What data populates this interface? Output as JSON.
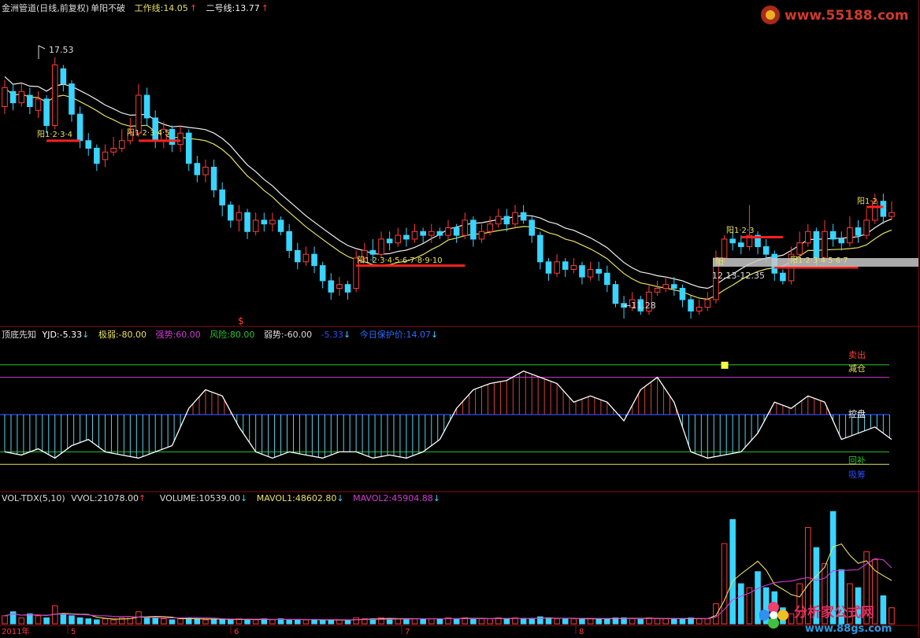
{
  "main_header": {
    "title": "金洲管道(日线,前复权)",
    "indicator": "单阳不破",
    "work_line_label": "工作线:",
    "work_line_value": "14.05",
    "line2_label": "二号线:",
    "line2_value": "13.77"
  },
  "main_annotations": {
    "high_price": "17.53",
    "low_price": "←11.28",
    "range": "12.13-12.35",
    "band_label": "阳",
    "sell_marker": "$",
    "yang_labels": [
      {
        "text": "阳1·2·3·4"
      },
      {
        "text": "阳1·2·3·4·5"
      },
      {
        "text": "阳1·2·3·4·5·6·7·8·9·10"
      },
      {
        "text": "阳1·2·3"
      },
      {
        "text": "阳1·2·3·4·5·6·7"
      },
      {
        "text": "阳1·2"
      }
    ]
  },
  "osc_header": {
    "name": "顶底先知",
    "yjd": "YJD:-5.33",
    "jiruo": "极弱:-80.00",
    "qiangshi": "强势:60.00",
    "fengxian": "风险:80.00",
    "ruoshi": "弱势:-60.00",
    "value2": "-5.33",
    "protect": "今日保护价:14.07"
  },
  "osc_labels": {
    "sell": "卖出",
    "reduce": "减仓",
    "control": "控盘",
    "backfill": "回补",
    "buy": "吸筹"
  },
  "vol_header": {
    "name": "VOL-TDX(5,10)",
    "vvol": "VVOL:21078.00",
    "volume": "VOLUME:10539.00",
    "mavol1": "MAVOL1:48602.80",
    "mavol2": "MAVOL2:45904.88"
  },
  "date_axis": {
    "year": "2011年",
    "months": [
      "5",
      "6",
      "7",
      "8"
    ]
  },
  "watermarks": {
    "top": "www.55188.com",
    "bottom_cn": "分析家公式网",
    "bottom_url": "www.88gs.com"
  },
  "colors": {
    "up": "#ff3b3b",
    "down": "#39d4ff",
    "ma1": "#f0f0f0",
    "ma2": "#e8e060",
    "osc_line": "#ffffff",
    "level_green": "#29c529",
    "level_magenta": "#d23cd2",
    "level_blue": "#2a4cff",
    "level_yellow": "#e8e060"
  },
  "chart_data": [
    {
      "type": "candlestick",
      "title": "金洲管道(日线,前复权)",
      "ylim": [
        10.6,
        18.6
      ],
      "note_points": {
        "high": 17.53,
        "low": 11.28
      },
      "candles": [
        [
          16.2,
          16.7,
          16.9,
          16.0
        ],
        [
          16.6,
          16.3,
          16.8,
          16.1
        ],
        [
          16.3,
          16.6,
          16.8,
          16.2
        ],
        [
          16.5,
          16.2,
          16.7,
          16.0
        ],
        [
          16.1,
          16.4,
          16.6,
          15.9
        ],
        [
          16.4,
          15.7,
          16.5,
          15.5
        ],
        [
          15.7,
          17.3,
          17.5,
          15.6
        ],
        [
          17.2,
          16.8,
          17.3,
          16.6
        ],
        [
          16.8,
          16.0,
          16.9,
          15.8
        ],
        [
          16.0,
          15.3,
          16.2,
          15.1
        ],
        [
          15.3,
          15.1,
          15.5,
          14.9
        ],
        [
          15.1,
          14.7,
          15.2,
          14.5
        ],
        [
          14.8,
          15.0,
          15.2,
          14.6
        ],
        [
          15.0,
          15.1,
          15.4,
          14.9
        ],
        [
          15.1,
          15.3,
          15.6,
          15.0
        ],
        [
          15.3,
          15.5,
          15.9,
          15.2
        ],
        [
          15.5,
          16.5,
          16.8,
          15.4
        ],
        [
          16.5,
          15.9,
          16.7,
          15.7
        ],
        [
          15.9,
          15.3,
          16.1,
          15.1
        ],
        [
          15.3,
          15.6,
          15.8,
          15.1
        ],
        [
          15.6,
          15.2,
          15.7,
          15.0
        ],
        [
          15.2,
          15.5,
          15.7,
          15.0
        ],
        [
          15.5,
          14.7,
          15.6,
          14.5
        ],
        [
          14.7,
          14.4,
          14.9,
          14.2
        ],
        [
          14.4,
          14.6,
          14.8,
          14.2
        ],
        [
          14.6,
          14.0,
          14.8,
          13.8
        ],
        [
          14.0,
          13.6,
          14.2,
          13.3
        ],
        [
          13.6,
          13.2,
          13.7,
          13.0
        ],
        [
          13.2,
          13.4,
          13.6,
          12.9
        ],
        [
          13.4,
          12.9,
          13.5,
          12.7
        ],
        [
          12.9,
          13.2,
          13.4,
          12.8
        ],
        [
          13.2,
          13.1,
          13.4,
          12.9
        ],
        [
          13.1,
          13.2,
          13.4,
          12.9
        ],
        [
          13.2,
          12.9,
          13.3,
          12.8
        ],
        [
          12.9,
          12.4,
          13.1,
          12.2
        ],
        [
          12.4,
          12.1,
          12.6,
          11.9
        ],
        [
          12.1,
          12.3,
          12.5,
          12.0
        ],
        [
          12.3,
          12.0,
          12.5,
          11.8
        ],
        [
          12.0,
          11.6,
          12.1,
          11.4
        ],
        [
          11.6,
          11.3,
          11.8,
          11.1
        ],
        [
          11.4,
          11.5,
          11.7,
          11.2
        ],
        [
          11.5,
          11.3,
          11.6,
          11.1
        ],
        [
          11.4,
          12.2,
          12.4,
          11.3
        ],
        [
          12.2,
          12.4,
          12.6,
          12.1
        ],
        [
          12.4,
          12.3,
          12.7,
          12.1
        ],
        [
          12.3,
          12.7,
          12.9,
          12.2
        ],
        [
          12.7,
          12.6,
          12.9,
          12.4
        ],
        [
          12.6,
          12.8,
          13.0,
          12.5
        ],
        [
          12.8,
          12.7,
          13.0,
          12.5
        ],
        [
          12.7,
          12.9,
          13.1,
          12.6
        ],
        [
          12.9,
          12.8,
          13.0,
          12.6
        ],
        [
          12.8,
          12.9,
          13.1,
          12.6
        ],
        [
          12.9,
          12.8,
          13.0,
          12.7
        ],
        [
          12.8,
          13.0,
          13.2,
          12.7
        ],
        [
          13.0,
          12.8,
          13.1,
          12.6
        ],
        [
          12.8,
          13.2,
          13.4,
          12.7
        ],
        [
          13.2,
          12.7,
          13.3,
          12.5
        ],
        [
          12.7,
          12.9,
          13.1,
          12.6
        ],
        [
          12.9,
          13.1,
          13.3,
          12.8
        ],
        [
          13.1,
          13.3,
          13.5,
          13.0
        ],
        [
          13.3,
          13.1,
          13.5,
          12.9
        ],
        [
          13.1,
          13.4,
          13.6,
          13.0
        ],
        [
          13.4,
          13.2,
          13.6,
          13.1
        ],
        [
          13.2,
          12.8,
          13.3,
          12.6
        ],
        [
          12.8,
          12.1,
          12.9,
          11.9
        ],
        [
          12.1,
          11.8,
          12.2,
          11.6
        ],
        [
          11.8,
          12.1,
          12.3,
          11.7
        ],
        [
          12.1,
          11.9,
          12.2,
          11.7
        ],
        [
          11.9,
          12.0,
          12.2,
          11.8
        ],
        [
          12.0,
          11.7,
          12.1,
          11.5
        ],
        [
          11.7,
          11.9,
          12.1,
          11.6
        ],
        [
          11.9,
          11.8,
          12.1,
          11.6
        ],
        [
          11.8,
          11.5,
          12.0,
          11.3
        ],
        [
          11.5,
          11.0,
          11.6,
          10.9
        ],
        [
          11.0,
          10.9,
          11.2,
          10.6
        ],
        [
          10.9,
          11.1,
          11.3,
          10.8
        ],
        [
          11.1,
          10.8,
          11.2,
          10.7
        ],
        [
          10.8,
          11.3,
          11.5,
          10.7
        ],
        [
          11.3,
          11.4,
          11.6,
          11.2
        ],
        [
          11.4,
          11.5,
          11.7,
          11.3
        ],
        [
          11.5,
          11.4,
          11.7,
          11.2
        ],
        [
          11.4,
          11.1,
          11.5,
          10.9
        ],
        [
          11.1,
          10.8,
          11.2,
          10.6
        ],
        [
          10.8,
          10.9,
          11.1,
          10.7
        ],
        [
          10.9,
          11.1,
          11.3,
          10.8
        ],
        [
          11.1,
          12.2,
          12.4,
          11.0
        ],
        [
          12.2,
          12.7,
          12.8,
          12.1
        ],
        [
          12.7,
          12.6,
          12.9,
          12.4
        ],
        [
          12.6,
          12.5,
          12.8,
          12.3
        ],
        [
          12.5,
          12.8,
          13.6,
          12.4
        ],
        [
          12.8,
          12.5,
          12.9,
          12.3
        ],
        [
          12.5,
          12.3,
          12.7,
          12.1
        ],
        [
          12.3,
          11.8,
          12.4,
          11.6
        ],
        [
          11.8,
          11.6,
          11.9,
          11.5
        ],
        [
          11.6,
          12.3,
          12.5,
          11.5
        ],
        [
          12.3,
          12.6,
          12.9,
          12.2
        ],
        [
          12.6,
          12.9,
          13.1,
          12.5
        ],
        [
          12.9,
          12.2,
          13.0,
          12.0
        ],
        [
          12.2,
          12.9,
          13.2,
          12.1
        ],
        [
          12.9,
          12.7,
          13.1,
          12.5
        ],
        [
          12.7,
          12.6,
          12.9,
          12.4
        ],
        [
          12.6,
          13.0,
          13.3,
          12.5
        ],
        [
          13.0,
          12.8,
          13.2,
          12.6
        ],
        [
          12.8,
          13.2,
          13.5,
          12.7
        ],
        [
          13.2,
          13.7,
          13.9,
          13.1
        ],
        [
          13.7,
          13.3,
          13.9,
          13.1
        ],
        [
          13.3,
          13.4,
          13.7,
          13.2
        ]
      ]
    },
    {
      "type": "line",
      "name": "顶底先知",
      "ylim": [
        -100,
        100
      ],
      "levels": {
        "风险": 80,
        "强势": 60,
        "弱势": -60,
        "极弱": -80
      },
      "x": [
        0,
        2,
        4,
        6,
        8,
        10,
        12,
        14,
        16,
        18,
        20,
        22,
        24,
        26,
        28,
        30,
        32,
        34,
        36,
        38,
        40,
        42,
        44,
        46,
        48,
        50,
        52,
        54,
        56,
        58,
        60,
        62,
        64,
        66,
        68,
        70,
        72,
        74,
        76,
        78,
        80,
        82,
        84,
        86,
        88,
        90,
        92,
        94,
        96,
        98,
        100,
        102,
        104,
        106
      ],
      "values": [
        -60,
        -65,
        -55,
        -70,
        -50,
        -40,
        -60,
        -65,
        -70,
        -60,
        -50,
        10,
        40,
        30,
        -20,
        -60,
        -70,
        -60,
        -65,
        -70,
        -60,
        -60,
        -70,
        -65,
        -70,
        -60,
        -40,
        10,
        40,
        50,
        55,
        70,
        60,
        50,
        20,
        30,
        20,
        -10,
        40,
        60,
        20,
        -60,
        -70,
        -65,
        -60,
        -30,
        20,
        10,
        30,
        20,
        -40,
        -30,
        -20,
        -40
      ]
    },
    {
      "type": "bar",
      "name": "VOL-TDX(5,10)",
      "ylim": [
        0,
        60000
      ],
      "values": [
        4000,
        6000,
        3000,
        5000,
        4000,
        3000,
        9000,
        5000,
        4000,
        3000,
        2500,
        2000,
        2500,
        2000,
        3000,
        3500,
        6000,
        3000,
        3000,
        2500,
        2000,
        2500,
        3000,
        2500,
        2000,
        2000,
        2500,
        2000,
        2500,
        2000,
        2000,
        2500,
        2000,
        2500,
        2000,
        2000,
        2000,
        2000,
        1800,
        1800,
        2000,
        1800,
        3000,
        2500,
        2500,
        3000,
        2500,
        2500,
        2500,
        2500,
        2500,
        2500,
        2500,
        3000,
        2500,
        3000,
        2500,
        2500,
        2500,
        3000,
        2500,
        3000,
        2500,
        2500,
        3500,
        3000,
        2500,
        2500,
        2500,
        2500,
        2500,
        2500,
        2500,
        3000,
        3000,
        2500,
        2500,
        3000,
        2500,
        2500,
        2500,
        2500,
        3000,
        2500,
        2500,
        10000,
        40000,
        52000,
        20000,
        18000,
        26000,
        18000,
        16000,
        8000,
        5000,
        20000,
        48000,
        38000,
        30000,
        56000,
        27000,
        20000,
        18000,
        36000,
        32000,
        14000,
        8000
      ]
    }
  ]
}
